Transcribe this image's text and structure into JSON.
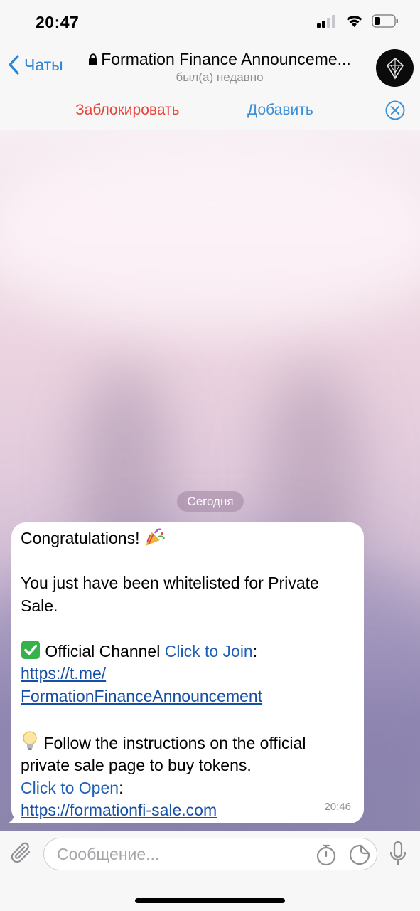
{
  "status_bar": {
    "time": "20:47"
  },
  "header": {
    "back_label": "Чаты",
    "title": "Formation Finance Announceme...",
    "subtitle": "был(а) недавно"
  },
  "actions": {
    "block_label": "Заблокировать",
    "add_label": "Добавить"
  },
  "chat": {
    "date_label": "Сегодня",
    "message": {
      "line1": "Congratulations!",
      "line2": "You just have been whitelisted for Private Sale.",
      "channel_label": "Official Channel",
      "channel_link_text": "Click to Join",
      "colon1": ":",
      "channel_url_part1": "https://t.me/",
      "channel_url_part2": "FormationFinanceAnnouncement",
      "instructions": "Follow the instructions on the official private sale page to buy tokens.",
      "open_link_text": "Click to Open",
      "colon2": ":",
      "sale_url": "https://formationfi-sale.com",
      "time": "20:46"
    }
  },
  "composer": {
    "placeholder": "Сообщение..."
  },
  "colors": {
    "accent": "#2e86d6",
    "danger": "#e5453a",
    "link": "#1f5fb5"
  },
  "icons": [
    "back-chevron-icon",
    "lock-icon",
    "avatar-logo-icon",
    "close-icon",
    "party-popper-icon",
    "check-mark-icon",
    "lightbulb-icon",
    "paperclip-icon",
    "timer-icon",
    "sticker-icon",
    "microphone-icon"
  ]
}
